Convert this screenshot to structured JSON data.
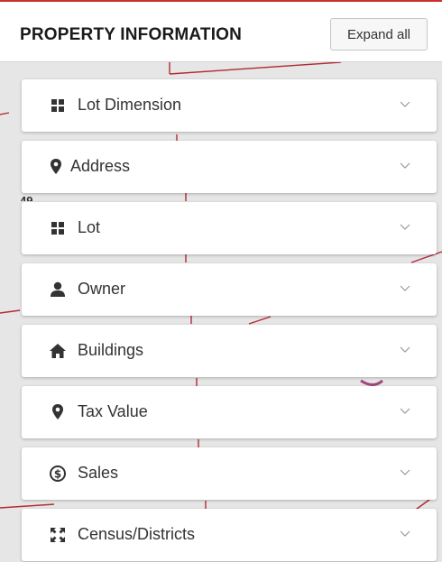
{
  "header": {
    "title": "PROPERTY INFORMATION",
    "expand_label": "Expand all"
  },
  "map": {
    "stray_label": "49"
  },
  "sections": [
    {
      "label": "Lot Dimension",
      "icon": "grid-icon"
    },
    {
      "label": "Address",
      "icon": "map-marker-icon"
    },
    {
      "label": "Lot",
      "icon": "grid-icon"
    },
    {
      "label": "Owner",
      "icon": "user-icon"
    },
    {
      "label": "Buildings",
      "icon": "home-icon"
    },
    {
      "label": "Tax Value",
      "icon": "map-marker-icon"
    },
    {
      "label": "Sales",
      "icon": "dollar-circle-icon"
    },
    {
      "label": "Census/Districts",
      "icon": "expand-arrows-icon"
    }
  ],
  "colors": {
    "map_line": "#b32a34",
    "icon": "#333333",
    "chevron": "#999999"
  }
}
